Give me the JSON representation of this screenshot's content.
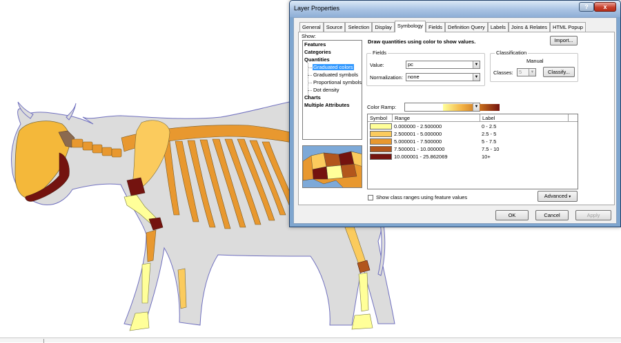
{
  "dialog": {
    "title": "Layer Properties",
    "help_label": "?",
    "close_label": "x",
    "tabs": [
      "General",
      "Source",
      "Selection",
      "Display",
      "Symbology",
      "Fields",
      "Definition Query",
      "Labels",
      "Joins & Relates",
      "HTML Popup"
    ],
    "active_tab": "Symbology",
    "show_label": "Show:",
    "tree": {
      "features": "Features",
      "categories": "Categories",
      "quantities": "Quantities",
      "graduated_colors": "Graduated colors",
      "graduated_symbols": "Graduated symbols",
      "proportional_symbols": "Proportional symbols",
      "dot_density": "Dot density",
      "charts": "Charts",
      "multiple_attributes": "Multiple Attributes"
    },
    "description": "Draw quantities using color to show values.",
    "import_label": "Import...",
    "fields": {
      "title": "Fields",
      "value_label": "Value:",
      "value": "pc",
      "normalization_label": "Normalization:",
      "normalization": "none"
    },
    "classification": {
      "title": "Classification",
      "method": "Manual",
      "classes_label": "Classes:",
      "classes": "5",
      "classify_label": "Classify..."
    },
    "color_ramp_label": "Color Ramp:",
    "table": {
      "headers": [
        "Symbol",
        "Range",
        "Label"
      ],
      "rows": [
        {
          "color": "#ffff99",
          "range": "0.000000 - 2.500000",
          "label": "0 - 2.5"
        },
        {
          "color": "#fbcb5d",
          "range": "2.500001 - 5.000000",
          "label": "2.5 - 5"
        },
        {
          "color": "#e8982f",
          "range": "5.000001 - 7.500000",
          "label": "5 - 7.5"
        },
        {
          "color": "#b2561c",
          "range": "7.500001 - 10.000000",
          "label": "7.5 - 10"
        },
        {
          "color": "#74130f",
          "range": "10.000001 - 25.862069",
          "label": "10+"
        }
      ]
    },
    "show_ranges_label": "Show class ranges using feature values",
    "advanced_label": "Advanced",
    "ok_label": "OK",
    "cancel_label": "Cancel",
    "apply_label": "Apply"
  },
  "colors": {
    "body_fill": "#dcdcdc",
    "body_outline": "#6f6fbf",
    "class1": "#ffff99",
    "class2": "#fbcb5d",
    "class3": "#e8982f",
    "class4": "#b2561c",
    "class5": "#74130f"
  }
}
